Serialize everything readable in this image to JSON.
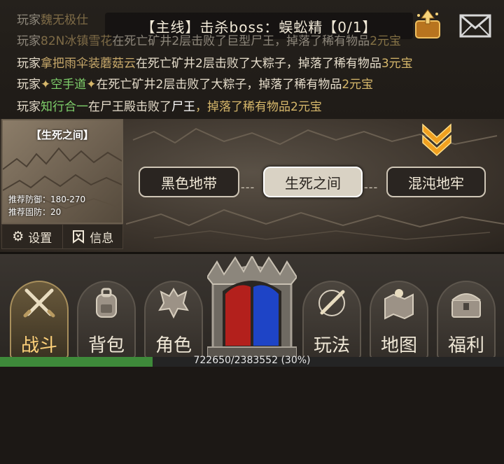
{
  "quest": {
    "text": "【主线】击杀boss：蜈蚣精【0/1】"
  },
  "chat": {
    "lines": [
      {
        "prefix": "玩家",
        "name": "魏无极仕",
        "rest": "",
        "item": "",
        "reward": ""
      },
      {
        "prefix": "玩家",
        "name": "82N冰镇雪花",
        "rest": "在死亡矿井2层击败了巨型尸王，掉落了稀有物品",
        "item": "",
        "reward": "2元宝"
      },
      {
        "prefix": "玩家",
        "name": "拿把雨伞装蘑菇云",
        "rest": "在死亡矿井2层击败了大粽子，掉落了稀有物品",
        "item": "",
        "reward": "3元宝"
      },
      {
        "prefix": "玩家",
        "name": "空手道",
        "rest": "在死亡矿井2层击败了大粽子，掉落了稀有物品",
        "item": "",
        "reward": "2元宝"
      },
      {
        "prefix": "玩家",
        "name": "知行合一",
        "rest": "在尸王殿击败了",
        "item": "尸王",
        "reward": "，掉落了稀有物品2元宝"
      }
    ]
  },
  "map": {
    "current": "【生死之间】",
    "rec_def_label": "推荐防御：",
    "rec_def_value": "180-270",
    "rec_hard_label": "推荐固防：",
    "rec_hard_value": "20",
    "settings_label": "设置",
    "info_label": "信息",
    "nodes": [
      "黑色地带",
      "生死之间",
      "混沌地牢"
    ],
    "dash": "---"
  },
  "nav": {
    "items": [
      "战斗",
      "背包",
      "角色",
      "玩法",
      "地图",
      "福利"
    ]
  },
  "xp": {
    "text": "722650/2383552 (30%)",
    "fraction": 0.303
  },
  "colors": {
    "accent": "#ffd27a",
    "xp": "#3e8a3a"
  }
}
